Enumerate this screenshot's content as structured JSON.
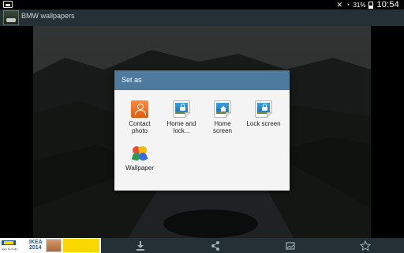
{
  "status_bar": {
    "battery_percent": "31%",
    "time": "10:54"
  },
  "action_bar": {
    "title": "BMW wallpapers"
  },
  "dialog": {
    "title": "Set as",
    "options": [
      {
        "label_line1": "Contact",
        "label_line2": "photo",
        "icon": "contact-icon"
      },
      {
        "label_line1": "Home and",
        "label_line2": "lock...",
        "icon": "home-and-lock-screen-icon"
      },
      {
        "label_line1": "Home",
        "label_line2": "screen",
        "icon": "home-screen-icon"
      },
      {
        "label_line1": "Lock screen",
        "label_line2": "",
        "icon": "lock-screen-icon"
      },
      {
        "label_line1": "Wallpaper",
        "label_line2": "",
        "icon": "wallpaper-pinwheel-icon"
      }
    ]
  },
  "bottom_bar": {
    "ad": {
      "brand": "IKEA",
      "year": "2014",
      "small_text": "Hjem fra Kraljic"
    },
    "icons": [
      "download-icon",
      "share-icon",
      "set-as-icon",
      "favorite-star-icon"
    ]
  }
}
